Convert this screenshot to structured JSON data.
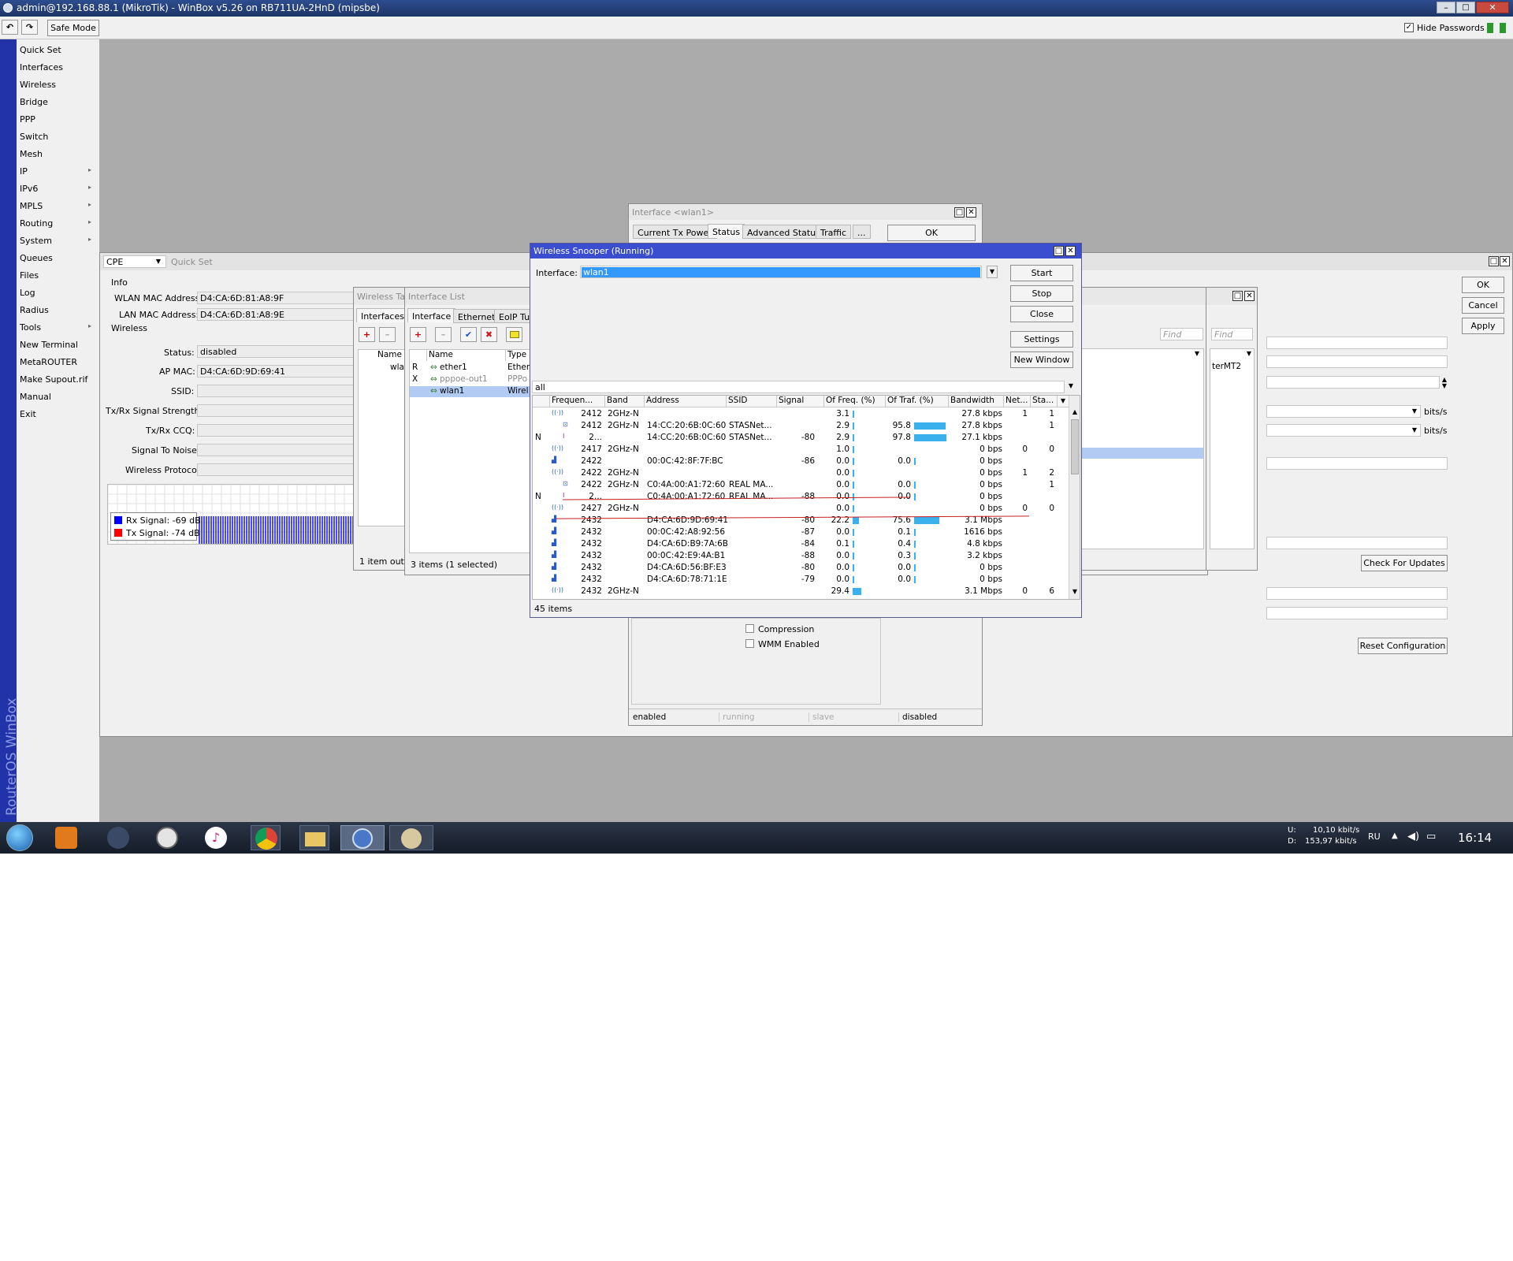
{
  "window": {
    "title": "admin@192.168.88.1 (MikroTik) - WinBox v5.26 on RB711UA-2HnD (mipsbe)"
  },
  "toolbar": {
    "safe_mode": "Safe Mode",
    "hide_passwords": "Hide Passwords",
    "hide_passwords_checked": true
  },
  "sidebar": {
    "brand": "RouterOS WinBox",
    "items": [
      {
        "label": "Quick Set",
        "submenu": false
      },
      {
        "label": "Interfaces",
        "submenu": false
      },
      {
        "label": "Wireless",
        "submenu": false
      },
      {
        "label": "Bridge",
        "submenu": false
      },
      {
        "label": "PPP",
        "submenu": false
      },
      {
        "label": "Switch",
        "submenu": false
      },
      {
        "label": "Mesh",
        "submenu": false
      },
      {
        "label": "IP",
        "submenu": true
      },
      {
        "label": "IPv6",
        "submenu": true
      },
      {
        "label": "MPLS",
        "submenu": true
      },
      {
        "label": "Routing",
        "submenu": true
      },
      {
        "label": "System",
        "submenu": true
      },
      {
        "label": "Queues",
        "submenu": false
      },
      {
        "label": "Files",
        "submenu": false
      },
      {
        "label": "Log",
        "submenu": false
      },
      {
        "label": "Radius",
        "submenu": false
      },
      {
        "label": "Tools",
        "submenu": true
      },
      {
        "label": "New Terminal",
        "submenu": false
      },
      {
        "label": "MetaROUTER",
        "submenu": false
      },
      {
        "label": "Make Supout.rif",
        "submenu": false
      },
      {
        "label": "Manual",
        "submenu": false
      },
      {
        "label": "Exit",
        "submenu": false
      }
    ]
  },
  "quickset": {
    "mode": "CPE",
    "title": "Quick Set",
    "info_section": "Info",
    "wlan_mac_label": "WLAN MAC Address:",
    "wlan_mac": "D4:CA:6D:81:A8:9F",
    "lan_mac_label": "LAN MAC Address:",
    "lan_mac": "D4:CA:6D:81:A8:9E",
    "wireless_section": "Wireless",
    "status_label": "Status:",
    "status": "disabled",
    "ap_mac_label": "AP MAC:",
    "ap_mac": "D4:CA:6D:9D:69:41",
    "ssid_label": "SSID:",
    "signal_label": "Tx/Rx Signal Strength:",
    "ccq_label": "Tx/Rx CCQ:",
    "snr_label": "Signal To Noise:",
    "protocol_label": "Wireless Protocol:",
    "rx_signal": "Rx Signal:  -69 dB",
    "tx_signal": "Tx Signal:  -74 dB",
    "rx_color": "#0000ff",
    "tx_color": "#ff0000",
    "ok": "OK",
    "cancel": "Cancel",
    "apply": "Apply",
    "bits1": "bits/s",
    "bits2": "bits/s",
    "check_updates": "Check For Updates",
    "reset_config": "Reset Configuration",
    "partial_text": "terMT2"
  },
  "wireless_tables": {
    "title": "Wireless Ta",
    "tab": "Interfaces",
    "col_name": "Name",
    "row": "wla",
    "footer": "1 item out o"
  },
  "interface_list": {
    "title": "Interface List",
    "tabs": [
      "Interface",
      "Ethernet",
      "EoIP Tu"
    ],
    "col_name": "Name",
    "col_type": "Type",
    "rows": [
      {
        "flag": "R",
        "name": "ether1",
        "type": "Ether"
      },
      {
        "flag": "X",
        "name": "pppoe-out1",
        "type": "PPPo"
      },
      {
        "flag": "",
        "name": "wlan1",
        "type": "Wirel"
      }
    ],
    "footer": "3 items (1 selected)"
  },
  "iface_wlan1": {
    "title": "Interface <wlan1>",
    "tabs": [
      "Current Tx Power",
      "Status",
      "Advanced Status",
      "Traffic",
      "..."
    ],
    "ok": "OK",
    "compression": "Compression",
    "wmm": "WMM Enabled",
    "status_bar": [
      "enabled",
      "running",
      "slave",
      "disabled"
    ]
  },
  "find": {
    "placeholder1": "Find",
    "placeholder2": "Find"
  },
  "snooper": {
    "title": "Wireless Snooper (Running)",
    "interface_label": "Interface:",
    "interface": "wlan1",
    "buttons": [
      "Start",
      "Stop",
      "Close",
      "Settings",
      "New Window"
    ],
    "filter": "all",
    "columns": [
      "Frequen...",
      "Band",
      "Address",
      "SSID",
      "Signal",
      "Of Freq. (%)",
      "Of Traf. (%)",
      "Bandwidth",
      "Net...",
      "Sta..."
    ],
    "rows": [
      {
        "flag": "",
        "icon": "ap",
        "freq": "2412",
        "band": "2GHz-N",
        "addr": "",
        "ssid": "",
        "signal": "",
        "offreq": "3.1",
        "offreq_pct": 3.1,
        "oftraf": "",
        "oftraf_pct": 0,
        "bw": "27.8 kbps",
        "net": "1",
        "sta": "1"
      },
      {
        "flag": "",
        "icon": "net",
        "freq": "2412",
        "band": "2GHz-N",
        "addr": "14:CC:20:6B:0C:60",
        "ssid": "STASNet...",
        "signal": "",
        "offreq": "2.9",
        "offreq_pct": 2.9,
        "oftraf": "95.8",
        "oftraf_pct": 95.8,
        "bw": "27.8 kbps",
        "net": "",
        "sta": "1"
      },
      {
        "flag": "N",
        "icon": "sta",
        "freq": "2...",
        "band": "",
        "addr": "14:CC:20:6B:0C:60",
        "ssid": "STASNet...",
        "signal": "-80",
        "offreq": "2.9",
        "offreq_pct": 2.9,
        "oftraf": "97.8",
        "oftraf_pct": 97.8,
        "bw": "27.1 kbps",
        "net": "",
        "sta": ""
      },
      {
        "flag": "",
        "icon": "ap",
        "freq": "2417",
        "band": "2GHz-N",
        "addr": "",
        "ssid": "",
        "signal": "",
        "offreq": "1.0",
        "offreq_pct": 1.0,
        "oftraf": "",
        "oftraf_pct": 0,
        "bw": "0 bps",
        "net": "0",
        "sta": "0"
      },
      {
        "flag": "",
        "icon": "dev",
        "freq": "2422",
        "band": "",
        "addr": "00:0C:42:8F:7F:BC",
        "ssid": "",
        "signal": "-86",
        "offreq": "0.0",
        "offreq_pct": 0,
        "oftraf": "0.0",
        "oftraf_pct": 0,
        "bw": "0 bps",
        "net": "",
        "sta": ""
      },
      {
        "flag": "",
        "icon": "ap",
        "freq": "2422",
        "band": "2GHz-N",
        "addr": "",
        "ssid": "",
        "signal": "",
        "offreq": "0.0",
        "offreq_pct": 0,
        "oftraf": "",
        "oftraf_pct": 0,
        "bw": "0 bps",
        "net": "1",
        "sta": "2"
      },
      {
        "flag": "",
        "icon": "net",
        "freq": "2422",
        "band": "2GHz-N",
        "addr": "C0:4A:00:A1:72:60",
        "ssid": "REAL MA...",
        "signal": "",
        "offreq": "0.0",
        "offreq_pct": 0,
        "oftraf": "0.0",
        "oftraf_pct": 0,
        "bw": "0 bps",
        "net": "",
        "sta": "1"
      },
      {
        "flag": "N",
        "icon": "sta",
        "freq": "2...",
        "band": "",
        "addr": "C0:4A:00:A1:72:60",
        "ssid": "REAL MA...",
        "signal": "-88",
        "offreq": "0.0",
        "offreq_pct": 0,
        "oftraf": "0.0",
        "oftraf_pct": 0,
        "bw": "0 bps",
        "net": "",
        "sta": ""
      },
      {
        "flag": "",
        "icon": "ap",
        "freq": "2427",
        "band": "2GHz-N",
        "addr": "",
        "ssid": "",
        "signal": "",
        "offreq": "0.0",
        "offreq_pct": 0,
        "oftraf": "",
        "oftraf_pct": 0,
        "bw": "0 bps",
        "net": "0",
        "sta": "0"
      },
      {
        "flag": "",
        "icon": "dev",
        "freq": "2432",
        "band": "",
        "addr": "D4:CA:6D:9D:69:41",
        "ssid": "",
        "signal": "-80",
        "offreq": "22.2",
        "offreq_pct": 22.2,
        "oftraf": "75.6",
        "oftraf_pct": 75.6,
        "bw": "3.1 Mbps",
        "net": "",
        "sta": ""
      },
      {
        "flag": "",
        "icon": "dev",
        "freq": "2432",
        "band": "",
        "addr": "00:0C:42:A8:92:56",
        "ssid": "",
        "signal": "-87",
        "offreq": "0.0",
        "offreq_pct": 0,
        "oftraf": "0.1",
        "oftraf_pct": 0.1,
        "bw": "1616 bps",
        "net": "",
        "sta": ""
      },
      {
        "flag": "",
        "icon": "dev",
        "freq": "2432",
        "band": "",
        "addr": "D4:CA:6D:B9:7A:6B",
        "ssid": "",
        "signal": "-84",
        "offreq": "0.1",
        "offreq_pct": 0.1,
        "oftraf": "0.4",
        "oftraf_pct": 0.4,
        "bw": "4.8 kbps",
        "net": "",
        "sta": ""
      },
      {
        "flag": "",
        "icon": "dev",
        "freq": "2432",
        "band": "",
        "addr": "00:0C:42:E9:4A:B1",
        "ssid": "",
        "signal": "-88",
        "offreq": "0.0",
        "offreq_pct": 0,
        "oftraf": "0.3",
        "oftraf_pct": 0.3,
        "bw": "3.2 kbps",
        "net": "",
        "sta": ""
      },
      {
        "flag": "",
        "icon": "dev",
        "freq": "2432",
        "band": "",
        "addr": "D4:CA:6D:56:BF:E3",
        "ssid": "",
        "signal": "-80",
        "offreq": "0.0",
        "offreq_pct": 0,
        "oftraf": "0.0",
        "oftraf_pct": 0,
        "bw": "0 bps",
        "net": "",
        "sta": ""
      },
      {
        "flag": "",
        "icon": "dev",
        "freq": "2432",
        "band": "",
        "addr": "D4:CA:6D:78:71:1E",
        "ssid": "",
        "signal": "-79",
        "offreq": "0.0",
        "offreq_pct": 0,
        "oftraf": "0.0",
        "oftraf_pct": 0,
        "bw": "0 bps",
        "net": "",
        "sta": ""
      },
      {
        "flag": "",
        "icon": "ap",
        "freq": "2432",
        "band": "2GHz-N",
        "addr": "",
        "ssid": "",
        "signal": "",
        "offreq": "29.4",
        "offreq_pct": 29.4,
        "oftraf": "",
        "oftraf_pct": 0,
        "bw": "3.1 Mbps",
        "net": "0",
        "sta": "6"
      }
    ],
    "footer": "45 items"
  },
  "taskbar": {
    "apps": [
      "start-orb",
      "media-player",
      "steam",
      "clock-app",
      "itunes",
      "chrome",
      "file-explorer",
      "winbox",
      "paint"
    ],
    "net_u_label": "U:",
    "net_d_label": "D:",
    "net_up": "10,10 kbit/s",
    "net_down": "153,97 kbit/s",
    "lang": "RU",
    "time": "16:14"
  }
}
